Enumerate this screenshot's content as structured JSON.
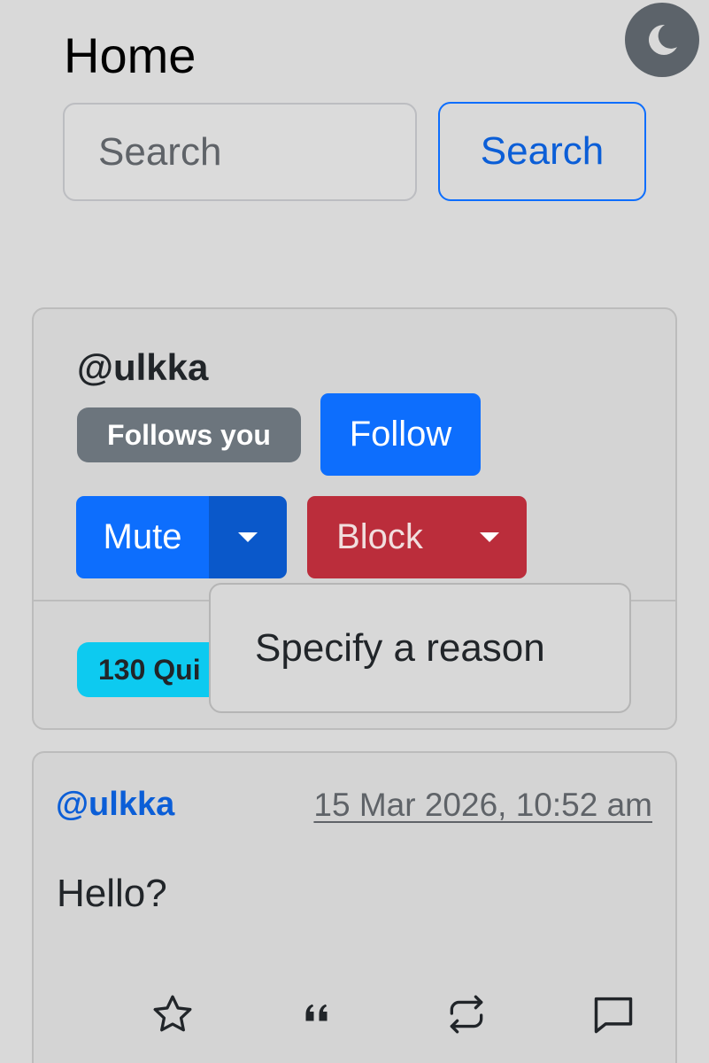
{
  "header": {
    "title": "Home",
    "theme_toggle_icon": "moon-icon"
  },
  "search": {
    "placeholder": "Search",
    "value": "",
    "button_label": "Search"
  },
  "profile": {
    "username": "@ulkka",
    "follows_badge": "Follows you",
    "follow_label": "Follow",
    "mute_label": "Mute",
    "block_label": "Block",
    "stat_badge": "130 Qui",
    "dropdown_items": [
      "Specify a reason"
    ]
  },
  "post": {
    "author": "@ulkka",
    "timestamp": "15 Mar 2026, 10:52 am",
    "body": "Hello?",
    "actions": [
      "star-icon",
      "quote-icon",
      "repost-icon",
      "reply-icon"
    ]
  },
  "colors": {
    "primary": "#0d6efd",
    "danger": "#bb2d3b",
    "secondary": "#6c757d",
    "info": "#0dcaf0"
  }
}
